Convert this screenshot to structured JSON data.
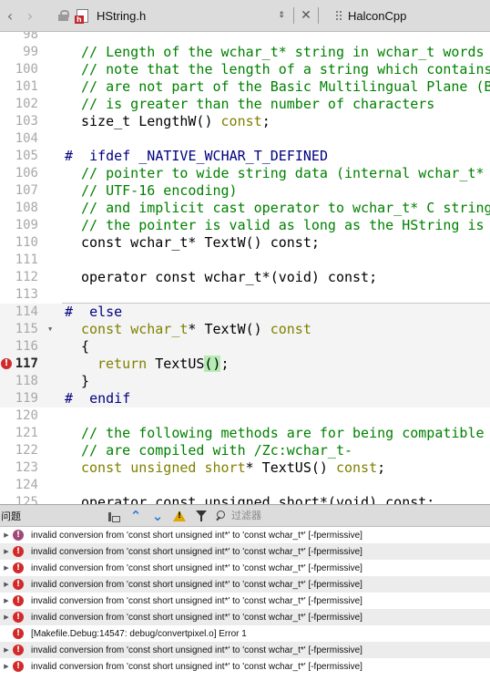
{
  "topbar": {
    "back_glyph": "‹",
    "forward_glyph": "›",
    "file_name": "HString.h",
    "file_badge": "h",
    "updown_glyph": "⇕",
    "close_glyph": "✕",
    "project_name": "HalconCpp"
  },
  "editor": {
    "lines": [
      {
        "num": "98",
        "code": ""
      },
      {
        "num": "99",
        "code": "// Length of the wchar_t* string in wchar_t words"
      },
      {
        "num": "100",
        "code": "// note that the length of a string which contains"
      },
      {
        "num": "101",
        "code": "// are not part of the Basic Multilingual Plane (B"
      },
      {
        "num": "102",
        "code": "// is greater than the number of characters"
      },
      {
        "num": "103",
        "code": "size_t LengthW() const;"
      },
      {
        "num": "104",
        "code": ""
      },
      {
        "num": "105",
        "code": "#  ifdef _NATIVE_WCHAR_T_DEFINED"
      },
      {
        "num": "106",
        "code": "// pointer to wide string data (internal wchar_t*"
      },
      {
        "num": "107",
        "code": "// UTF-16 encoding)"
      },
      {
        "num": "108",
        "code": "// and implicit cast operator to wchar_t* C string"
      },
      {
        "num": "109",
        "code": "// the pointer is valid as long as the HString is"
      },
      {
        "num": "110",
        "code": "const wchar_t* TextW() const;"
      },
      {
        "num": "111",
        "code": ""
      },
      {
        "num": "112",
        "code": "operator const wchar_t*(void) const;"
      },
      {
        "num": "113",
        "code": ""
      },
      {
        "num": "114",
        "code": "#  else"
      },
      {
        "num": "115",
        "code": "const wchar_t* TextW() const"
      },
      {
        "num": "116",
        "code": "{"
      },
      {
        "num": "117",
        "code": "return TextUS();"
      },
      {
        "num": "118",
        "code": "}"
      },
      {
        "num": "119",
        "code": "#  endif"
      },
      {
        "num": "120",
        "code": ""
      },
      {
        "num": "121",
        "code": "// the following methods are for being compatible"
      },
      {
        "num": "122",
        "code": "// are compiled with /Zc:wchar_t-"
      },
      {
        "num": "123",
        "code": "const unsigned short* TextUS() const;"
      },
      {
        "num": "124",
        "code": ""
      },
      {
        "num": "125",
        "code": "operator const unsigned short*(void) const;"
      }
    ],
    "error_line": "117",
    "error_glyph": "!"
  },
  "issues_panel": {
    "title": "问题",
    "filter_placeholder": "过滤器",
    "up_glyph": "⌃",
    "down_glyph": "⌄",
    "items": [
      {
        "text": "invalid conversion from 'const short unsigned int*' to 'const wchar_t*' [-fpermissive]",
        "kind": "error-purple",
        "expandable": true
      },
      {
        "text": "invalid conversion from 'const short unsigned int*' to 'const wchar_t*' [-fpermissive]",
        "kind": "error",
        "expandable": true
      },
      {
        "text": "invalid conversion from 'const short unsigned int*' to 'const wchar_t*' [-fpermissive]",
        "kind": "error",
        "expandable": true
      },
      {
        "text": "invalid conversion from 'const short unsigned int*' to 'const wchar_t*' [-fpermissive]",
        "kind": "error",
        "expandable": true
      },
      {
        "text": "invalid conversion from 'const short unsigned int*' to 'const wchar_t*' [-fpermissive]",
        "kind": "error",
        "expandable": true
      },
      {
        "text": "invalid conversion from 'const short unsigned int*' to 'const wchar_t*' [-fpermissive]",
        "kind": "error",
        "expandable": true
      },
      {
        "text": "[Makefile.Debug:14547: debug/convertpixel.o] Error 1",
        "kind": "error",
        "expandable": false
      },
      {
        "text": "invalid conversion from 'const short unsigned int*' to 'const wchar_t*' [-fpermissive]",
        "kind": "error",
        "expandable": true
      },
      {
        "text": "invalid conversion from 'const short unsigned int*' to 'const wchar_t*' [-fpermissive]",
        "kind": "error",
        "expandable": true
      }
    ]
  },
  "colors": {
    "comment": "#008000",
    "keyword": "#808000",
    "preprocessor": "#000080",
    "error": "#d12a2a",
    "toolbar_bg": "#dcdcdc"
  }
}
